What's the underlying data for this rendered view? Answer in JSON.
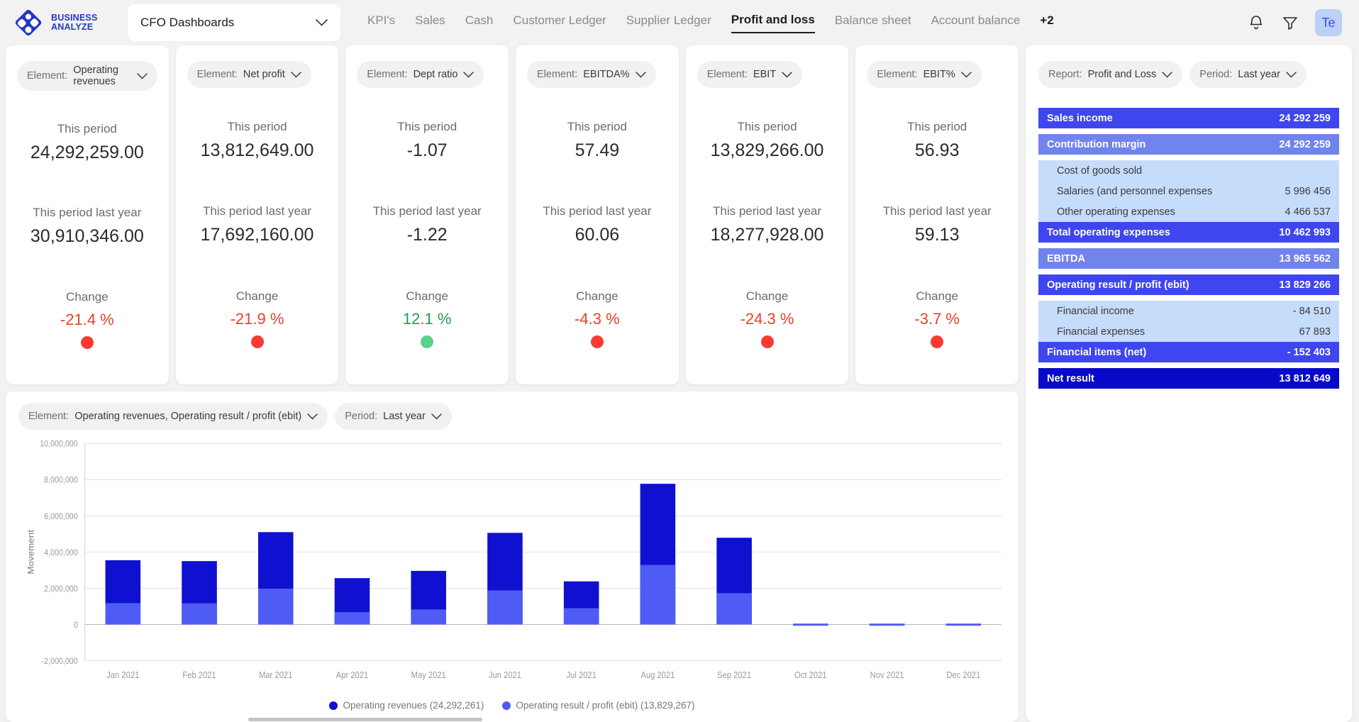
{
  "header": {
    "brand_line1": "BUSINESS",
    "brand_line2": "ANALYZE",
    "dashboard_select": "CFO Dashboards",
    "tabs": [
      {
        "label": "KPI's",
        "active": false
      },
      {
        "label": "Sales",
        "active": false
      },
      {
        "label": "Cash",
        "active": false
      },
      {
        "label": "Customer Ledger",
        "active": false
      },
      {
        "label": "Supplier Ledger",
        "active": false
      },
      {
        "label": "Profit and loss",
        "active": true
      },
      {
        "label": "Balance sheet",
        "active": false
      },
      {
        "label": "Account balance",
        "active": false
      }
    ],
    "more_tabs": "+2",
    "avatar_initials": "Te"
  },
  "kpi_cards": [
    {
      "filter_label": "Element:",
      "filter_value": "Operating revenues",
      "this_period_label": "This period",
      "this_period_value": "24,292,259.00",
      "last_year_label": "This period last year",
      "last_year_value": "30,910,346.00",
      "change_label": "Change",
      "change_value": "-21.4 %",
      "change_color": "#e8402a",
      "status_color": "#fa3a32"
    },
    {
      "filter_label": "Element:",
      "filter_value": "Net profit",
      "this_period_label": "This period",
      "this_period_value": "13,812,649.00",
      "last_year_label": "This period last year",
      "last_year_value": "17,692,160.00",
      "change_label": "Change",
      "change_value": "-21.9 %",
      "change_color": "#e8402a",
      "status_color": "#fa3a32"
    },
    {
      "filter_label": "Element:",
      "filter_value": "Dept ratio",
      "this_period_label": "This period",
      "this_period_value": "-1.07",
      "last_year_label": "This period last year",
      "last_year_value": "-1.22",
      "change_label": "Change",
      "change_value": "12.1 %",
      "change_color": "#1f9d4f",
      "status_color": "#5ad18b"
    },
    {
      "filter_label": "Element:",
      "filter_value": "EBITDA%",
      "this_period_label": "This period",
      "this_period_value": "57.49",
      "last_year_label": "This period last year",
      "last_year_value": "60.06",
      "change_label": "Change",
      "change_value": "-4.3 %",
      "change_color": "#e8402a",
      "status_color": "#fa3a32"
    },
    {
      "filter_label": "Element:",
      "filter_value": "EBIT",
      "this_period_label": "This period",
      "this_period_value": "13,829,266.00",
      "last_year_label": "This period last year",
      "last_year_value": "18,277,928.00",
      "change_label": "Change",
      "change_value": "-24.3 %",
      "change_color": "#e8402a",
      "status_color": "#fa3a32"
    },
    {
      "filter_label": "Element:",
      "filter_value": "EBIT%",
      "this_period_label": "This period",
      "this_period_value": "56.93",
      "last_year_label": "This period last year",
      "last_year_value": "59.13",
      "change_label": "Change",
      "change_value": "-3.7 %",
      "change_color": "#e8402a",
      "status_color": "#fa3a32"
    }
  ],
  "chart_filters": {
    "element_label": "Element:",
    "element_value": "Operating revenues, Operating result / profit (ebit)",
    "period_label": "Period:",
    "period_value": "Last year"
  },
  "chart_data": {
    "type": "bar",
    "title": "",
    "xlabel": "",
    "ylabel": "Movement",
    "ylim": [
      -2000000,
      10000000
    ],
    "ytick_labels": [
      "10,000,000",
      "8,000,000",
      "6,000,000",
      "4,000,000",
      "2,000,000",
      "0",
      "-2,000,000"
    ],
    "ytick_values": [
      10000000,
      8000000,
      6000000,
      4000000,
      2000000,
      0,
      -2000000
    ],
    "grid": true,
    "legend_position": "bottom",
    "categories": [
      "Jan 2021",
      "Feb 2021",
      "Mar 2021",
      "Apr 2021",
      "May 2021",
      "Jun 2021",
      "Jul 2021",
      "Aug 2021",
      "Sep 2021",
      "Oct 2021",
      "Nov 2021",
      "Dec 2021"
    ],
    "series": [
      {
        "name": "Operating revenues (24,292,261)",
        "color": "#1010d0",
        "values": [
          3550000,
          3500000,
          5100000,
          2560000,
          2960000,
          5060000,
          2380000,
          7770000,
          4790000,
          40000,
          40000,
          40000
        ]
      },
      {
        "name": "Operating result / profit (ebit) (13,829,267)",
        "color": "#4e5cf5",
        "values": [
          1180000,
          1170000,
          1980000,
          680000,
          830000,
          1880000,
          900000,
          3290000,
          1730000,
          20000,
          20000,
          20000
        ]
      }
    ]
  },
  "report_panel": {
    "report_label": "Report:",
    "report_value": "Profit and Loss",
    "period_label": "Period:",
    "period_value": "Last year",
    "rows": [
      {
        "label": "Sales income",
        "value": "24 292 259",
        "style": "head"
      },
      {
        "label": "",
        "value": "",
        "style": "gap"
      },
      {
        "label": "Contribution margin",
        "value": "24 292 259",
        "style": "sub"
      },
      {
        "label": "",
        "value": "",
        "style": "gap"
      },
      {
        "label": "Cost of goods sold",
        "value": "",
        "style": "detail"
      },
      {
        "label": "Salaries (and personnel expenses",
        "value": "5 996 456",
        "style": "detail"
      },
      {
        "label": "Other operating expenses",
        "value": "4 466 537",
        "style": "detail"
      },
      {
        "label": "Total operating expenses",
        "value": "10 462 993",
        "style": "head"
      },
      {
        "label": "",
        "value": "",
        "style": "gap"
      },
      {
        "label": "EBITDA",
        "value": "13 965 562",
        "style": "sub"
      },
      {
        "label": "",
        "value": "",
        "style": "gap"
      },
      {
        "label": "Operating result / profit (ebit)",
        "value": "13 829 266",
        "style": "head"
      },
      {
        "label": "",
        "value": "",
        "style": "gap"
      },
      {
        "label": "Financial income",
        "value": "- 84 510",
        "style": "detail"
      },
      {
        "label": "Financial expenses",
        "value": "67 893",
        "style": "detail"
      },
      {
        "label": "Financial items (net)",
        "value": "- 152 403",
        "style": "head"
      },
      {
        "label": "",
        "value": "",
        "style": "gap"
      },
      {
        "label": "Net result",
        "value": "13 812 649",
        "style": "total"
      }
    ]
  },
  "icons": {
    "bell": "bell-icon",
    "filter": "filter-icon",
    "chevron": "chevron-down-icon"
  }
}
